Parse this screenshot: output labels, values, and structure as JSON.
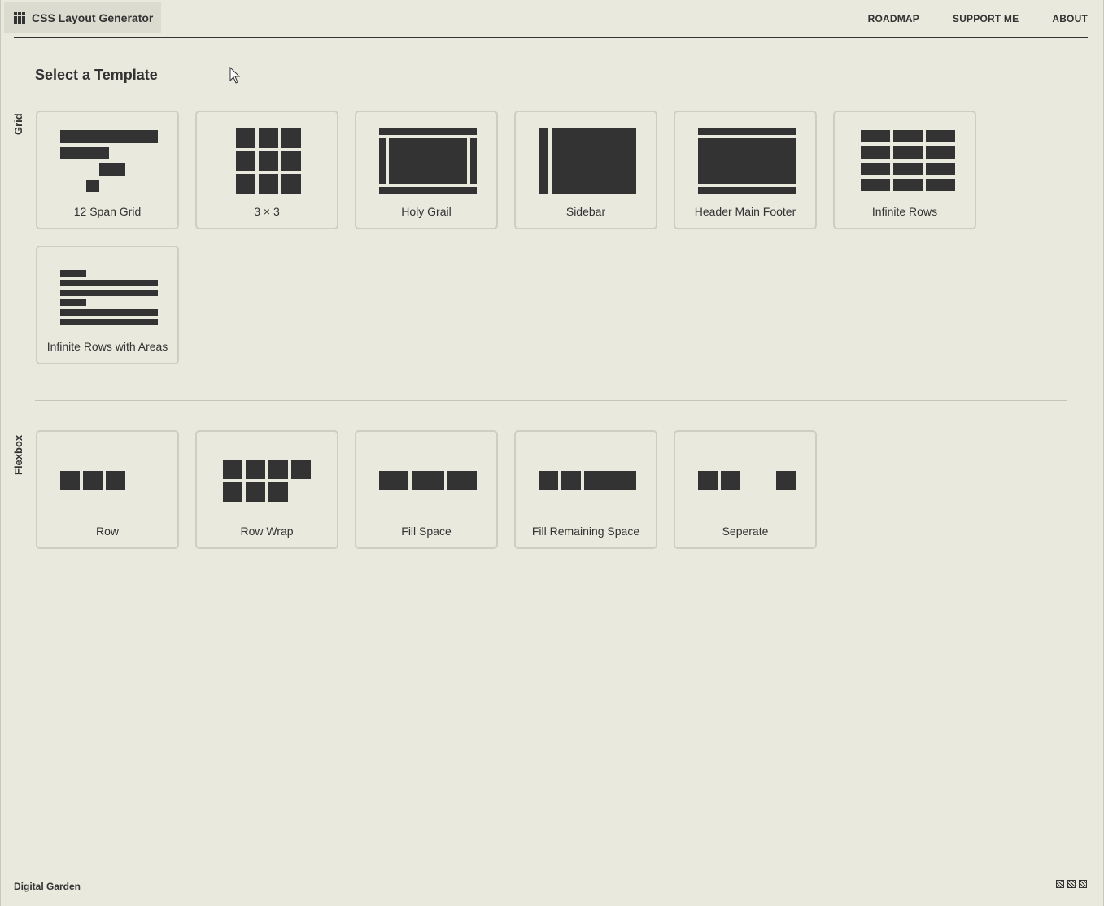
{
  "header": {
    "brand": "CSS Layout Generator",
    "nav": [
      "ROADMAP",
      "SUPPORT ME",
      "ABOUT"
    ]
  },
  "page_title": "Select a Template",
  "sections": {
    "grid": {
      "label": "Grid",
      "templates": [
        "12 Span Grid",
        "3 × 3",
        "Holy Grail",
        "Sidebar",
        "Header Main Footer",
        "Infinite Rows",
        "Infinite Rows with Areas"
      ]
    },
    "flexbox": {
      "label": "Flexbox",
      "templates": [
        "Row",
        "Row Wrap",
        "Fill Space",
        "Fill Remaining Space",
        "Seperate"
      ]
    }
  },
  "footer": {
    "text": "Digital Garden",
    "icons": [
      "pattern-icon",
      "pattern-icon",
      "pattern-icon"
    ]
  },
  "colors": {
    "background": "#eae9de",
    "ink": "#333333",
    "card_border": "#cfcec4"
  }
}
